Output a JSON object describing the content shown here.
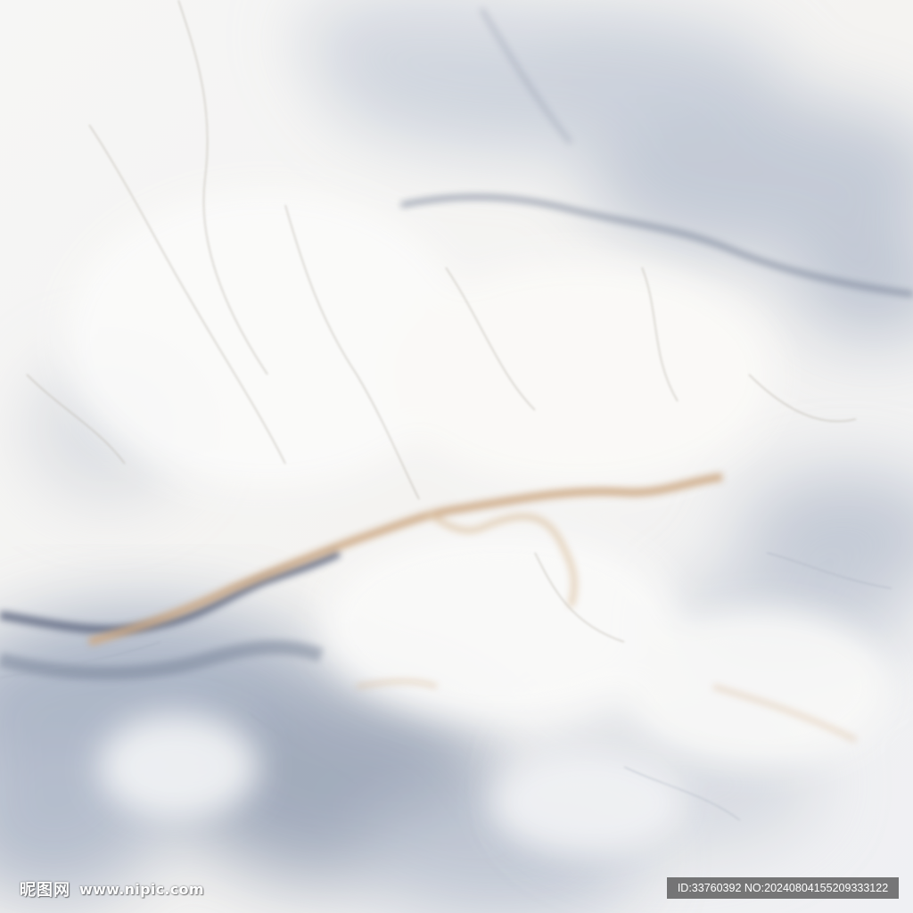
{
  "image": {
    "description": "White marble texture with grey-blue clouding and golden-brown veins",
    "colors": {
      "base": "#f4f4f3",
      "grey_blue": "#8c98ad",
      "dark_vein": "#4e5a72",
      "gold_vein": "#c9a27a"
    }
  },
  "watermark": {
    "brand": "昵图网",
    "url": "www.nipic.com",
    "id_text": "ID:33760392 NO:20240804155209333122"
  }
}
